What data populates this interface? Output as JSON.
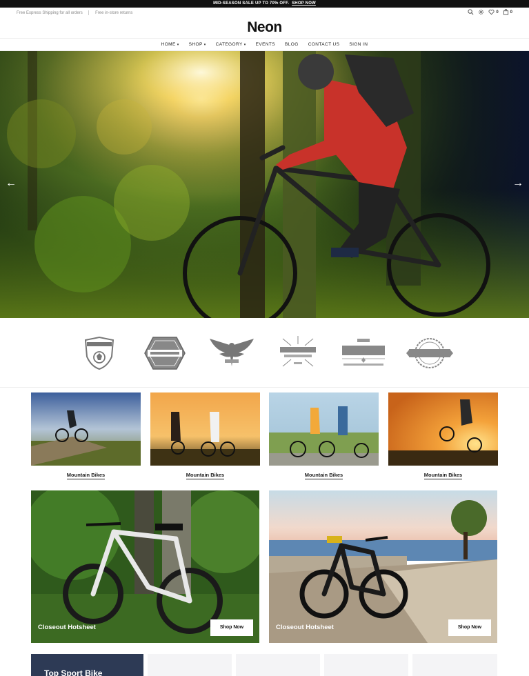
{
  "announcement": {
    "text": "MID-SEASON SALE UP TO 70% OFF.",
    "link": "SHOP NOW"
  },
  "utility": {
    "shipping": "Free Express Shipping for all orders",
    "returns": "Free in-store returns",
    "wishlist_count": "0",
    "cart_count": "0",
    "icons": [
      "search-icon",
      "settings-icon",
      "heart-icon",
      "cart-icon"
    ]
  },
  "logo": "Neon",
  "nav": {
    "items": [
      "HOME",
      "SHOP",
      "CATEGORY",
      "EVENTS",
      "BLOG",
      "CONTACT US",
      "SIGN IN"
    ]
  },
  "hero": {
    "prev_arrow": "←",
    "next_arrow": "→"
  },
  "brands": {
    "items": [
      {
        "name": "football-badge-logo"
      },
      {
        "name": "alienvalley-hexagon-logo"
      },
      {
        "name": "american-eagle-logo"
      },
      {
        "name": "jefferson-graphic-design-logo"
      },
      {
        "name": "the-vintage-logo"
      },
      {
        "name": "alienvalley-round-logo"
      }
    ]
  },
  "categories": {
    "items": [
      {
        "label": "Mountain Bikes"
      },
      {
        "label": "Mountain Bikes"
      },
      {
        "label": "Mountain Bikes"
      },
      {
        "label": "Mountain Bikes"
      }
    ]
  },
  "promos": {
    "items": [
      {
        "title": "Closeout Hotsheet",
        "button": "Shop Now"
      },
      {
        "title": "Closeout Hotsheet",
        "button": "Shop Now"
      }
    ]
  },
  "bottom_strip": {
    "title": "Top Sport Bike"
  },
  "colors": {
    "announce_bg": "#111111",
    "accent_text": "#222222",
    "strip_dark": "#2d3a55"
  }
}
